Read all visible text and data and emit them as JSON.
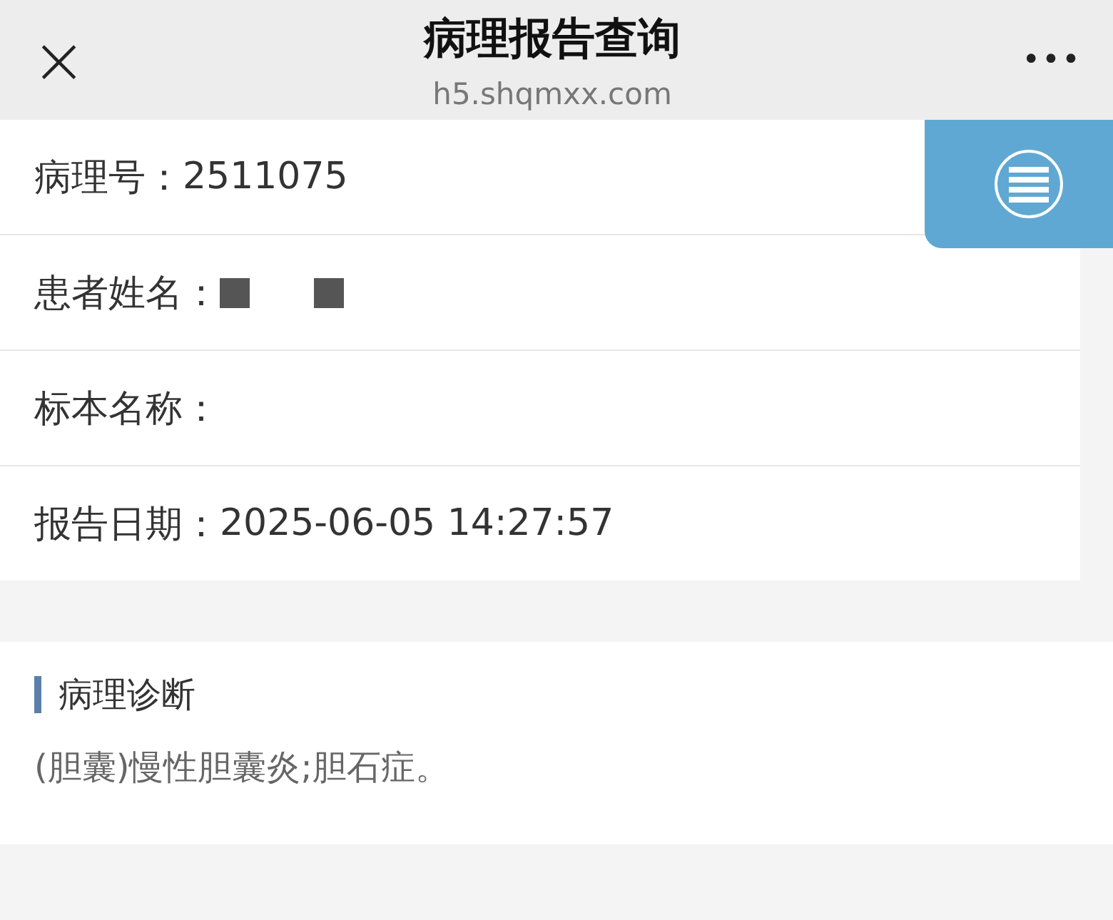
{
  "header": {
    "close_icon": "×",
    "title": "病理报告查询",
    "url": "h5.shqmxx.com",
    "more": "•••"
  },
  "fields": [
    {
      "label": "病理号：",
      "value": "2511075"
    },
    {
      "label": "患者姓名：",
      "redacted": true
    },
    {
      "label": "标本名称："
    },
    {
      "label": "报告日期：",
      "value": "2025-06-05 14:27:57"
    }
  ],
  "diagnosis": {
    "heading": "病理诊断",
    "text": "(胆囊)慢性胆囊炎;胆石症。"
  }
}
